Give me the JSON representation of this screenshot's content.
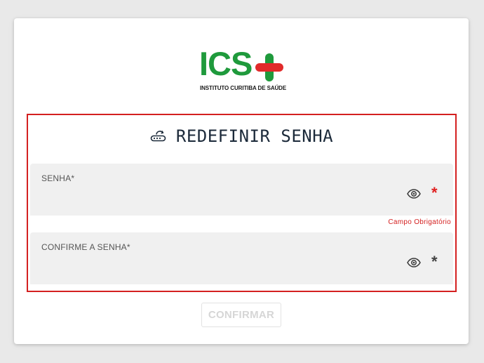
{
  "logo": {
    "letters": "ICS",
    "subtitle": "INSTITUTO CURITIBA DE SAÚDE",
    "colors": {
      "green": "#1f9a3c",
      "red": "#e12a2a"
    }
  },
  "form": {
    "title": "REDEFINIR SENHA",
    "title_icon": "password-reset-icon",
    "fields": [
      {
        "label": "SENHA*",
        "value": "",
        "toggle_icon": "eye-icon",
        "required_marker": "*",
        "error": "Campo Obrigatório"
      },
      {
        "label": "CONFIRME A SENHA*",
        "value": "",
        "toggle_icon": "eye-icon",
        "required_marker": "*"
      }
    ],
    "submit_label": "CONFIRMAR"
  },
  "colors": {
    "highlight_border": "#d42020",
    "error": "#e02020",
    "title": "#1c2a3a",
    "field_bg": "#f0f0f0"
  }
}
